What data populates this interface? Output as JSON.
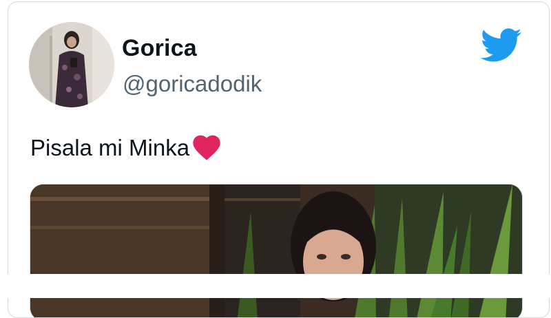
{
  "tweet": {
    "display_name": "Gorica",
    "handle": "@goricadodik",
    "text": "Pisala mi Minka",
    "emoji": "heart-icon"
  },
  "icons": {
    "brand": "twitter-bird-icon",
    "brand_color": "#1d9bf0",
    "heart_color": "#e0245e"
  }
}
